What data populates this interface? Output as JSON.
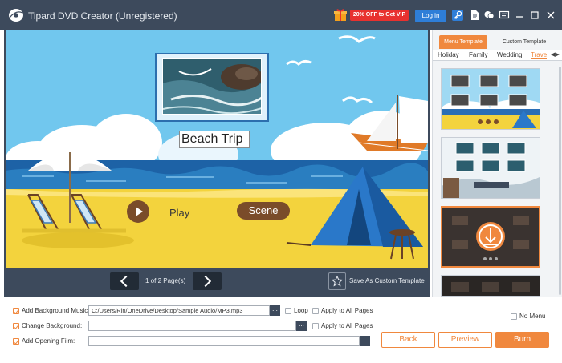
{
  "titlebar": {
    "app_title": "Tipard DVD Creator (Unregistered)",
    "promo_label": "20% OFF to Get VIP",
    "login_label": "Log in",
    "icons": [
      "logo-icon",
      "gift-icon",
      "key-icon",
      "document-icon",
      "chat-icon",
      "feedback-icon",
      "minimize-icon",
      "maximize-icon",
      "close-icon"
    ]
  },
  "preview": {
    "title_text": "Beach Trip",
    "play_label": "Play",
    "scene_label": "Scene",
    "page_indicator": "1 of 2 Page(s)",
    "save_template_label": "Save As Custom Template"
  },
  "templates": {
    "tabs": [
      "Menu Template",
      "Custom Template"
    ],
    "active_tab": "Menu Template",
    "categories": [
      "Holiday",
      "Family",
      "Wedding",
      "Trave"
    ],
    "active_category": "Trave",
    "selected_index": 2
  },
  "bottom": {
    "bg_music_label": "Add Background Music:",
    "bg_music_path": "C:/Users/Rin/OneDrive/Desktop/Sample Audio/MP3.mp3",
    "loop_label": "Loop",
    "apply_all_label_1": "Apply to All Pages",
    "change_bg_label": "Change Background:",
    "change_bg_path": "",
    "apply_all_label_2": "Apply to All Pages",
    "opening_film_label": "Add Opening Film:",
    "opening_film_path": "",
    "dots": "...",
    "no_menu_label": "No Menu",
    "back_label": "Back",
    "preview_label": "Preview",
    "burn_label": "Burn"
  },
  "colors": {
    "titlebar_bg": "#3d4a5c",
    "accent": "#f0883e",
    "promo_red": "#e8312f",
    "login_blue": "#2e7ed8"
  }
}
